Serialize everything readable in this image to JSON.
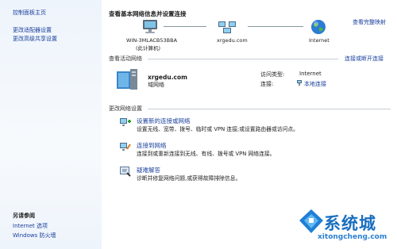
{
  "sidebar": {
    "home": "控制面板主页",
    "adapter": "更改适配器设置",
    "sharing": "更改高级共享设置",
    "see_also": "另请参阅",
    "internet_options": "Internet 选项",
    "firewall": "Windows 防火墙"
  },
  "header": {
    "title": "查看基本网络信息并设置连接",
    "full_map": "查看完整映射"
  },
  "map": {
    "computer_name": "WIN-3MLACB53BBA",
    "computer_sub": "(此计算机)",
    "network_name": "xrgedu.com",
    "internet_label": "Internet"
  },
  "active": {
    "title": "查看活动网络",
    "connect_link": "连接或断开连接",
    "network_name": "xrgedu.com",
    "network_type": "域网络",
    "access_type_label": "访问类型:",
    "access_type_value": "Internet",
    "connections_label": "连接:",
    "connections_value": "本地连接"
  },
  "change": {
    "title": "更改网络设置",
    "items": [
      {
        "label": "设置新的连接或网络",
        "desc": "设置无线、宽带、拨号、临时或 VPN 连接;或设置路由器或访问点。"
      },
      {
        "label": "连接到网络",
        "desc": "连接到或重新连接到无线、有线、拨号或 VPN 网络连接。"
      },
      {
        "label": "疑难解答",
        "desc": "诊断并修复网络问题,或获得故障排除信息。"
      }
    ]
  },
  "watermark": {
    "brand": "系统城",
    "url": "xitongcheng.com"
  },
  "colors": {
    "link": "#1a3f9c",
    "sidebar_bg": "#eef4fb",
    "rule": "#c7cfd8"
  }
}
